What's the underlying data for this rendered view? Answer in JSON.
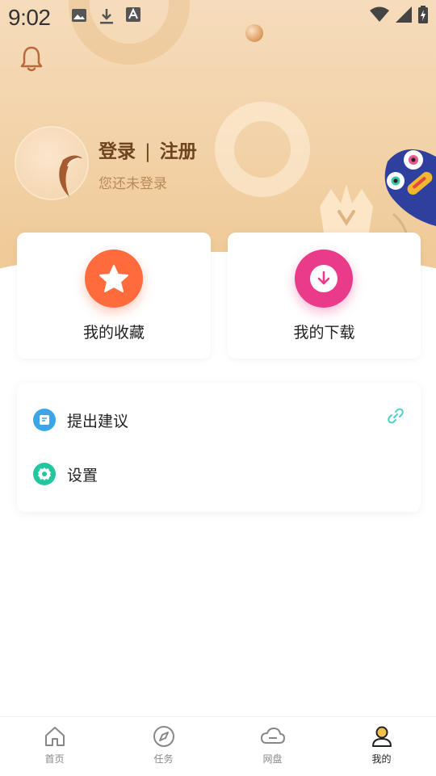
{
  "status_bar": {
    "time": "9:02",
    "left_icons": [
      "image-icon",
      "download-icon",
      "font-icon"
    ],
    "right_icons": [
      "wifi-icon",
      "signal-icon",
      "battery-icon"
    ]
  },
  "header": {
    "bell_icon": "bell-icon",
    "login": {
      "login_label": "登录",
      "separator": "|",
      "register_label": "注册"
    },
    "not_logged_in": "您还未登录"
  },
  "quick_actions": [
    {
      "label": "我的收藏",
      "icon": "star-icon",
      "color": "#ff6b3d"
    },
    {
      "label": "我的下载",
      "icon": "download-circle-icon",
      "color": "#ea3b8b"
    }
  ],
  "menu": {
    "items": [
      {
        "label": "提出建议",
        "icon": "feedback-icon",
        "color": "#3aa6e8"
      },
      {
        "label": "设置",
        "icon": "settings-gear-icon",
        "color": "#22c7a0"
      }
    ],
    "link_icon": "link-icon",
    "link_color": "#4fd1c5"
  },
  "bottom_nav": {
    "items": [
      {
        "label": "首页",
        "icon": "home-icon"
      },
      {
        "label": "任务",
        "icon": "compass-icon"
      },
      {
        "label": "网盘",
        "icon": "cloud-icon"
      },
      {
        "label": "我的",
        "icon": "profile-icon",
        "active": true
      }
    ]
  },
  "colors": {
    "header_bg_top": "#f6dcbc",
    "header_bg_bottom": "#efc995",
    "login_text": "#6d4320",
    "sub_text": "#b9895a",
    "nav_inactive": "#888888",
    "nav_active": "#222222"
  }
}
